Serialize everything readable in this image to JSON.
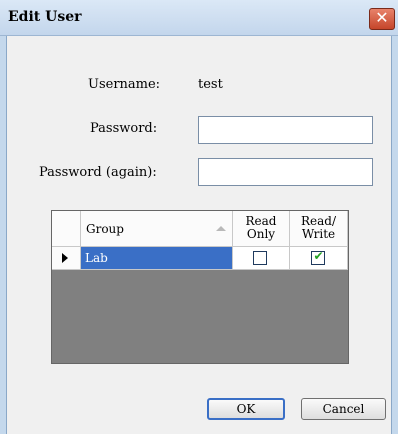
{
  "dialog": {
    "title": "Edit User",
    "close_glyph": "✕"
  },
  "form": {
    "username_label": "Username:",
    "username_value": "test",
    "password_label": "Password:",
    "password_value": "",
    "password_again_label": "Password (again):",
    "password_again_value": ""
  },
  "grid": {
    "columns": {
      "group": "Group",
      "read_only_line1": "Read",
      "read_only_line2": "Only",
      "read_write_line1": "Read/",
      "read_write_line2": "Write"
    },
    "rows": [
      {
        "group": "Lab",
        "read_only": false,
        "read_write": true,
        "selected": true
      }
    ]
  },
  "buttons": {
    "ok": "OK",
    "cancel": "Cancel"
  },
  "icons": {
    "close": "close-icon",
    "row_indicator": "row-pointer-icon",
    "sort": "sort-ascending-icon",
    "check": "checkmark-icon"
  },
  "colors": {
    "selection": "#3a6fc6",
    "close_button": "#c5452a",
    "check": "#22a022",
    "grid_background": "#808080"
  }
}
